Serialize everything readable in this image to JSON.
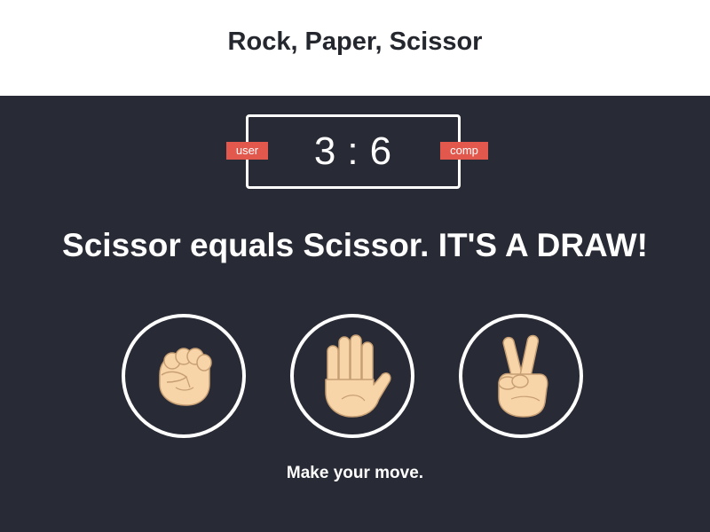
{
  "header": {
    "title": "Rock, Paper, Scissor"
  },
  "scoreboard": {
    "user_label": "user",
    "comp_label": "comp",
    "user_score": "3",
    "separator": ":",
    "comp_score": "6"
  },
  "result": {
    "message": "Scissor equals Scissor. IT'S A DRAW!"
  },
  "choices": [
    {
      "name": "rock",
      "icon": "fist-icon"
    },
    {
      "name": "paper",
      "icon": "open-hand-icon"
    },
    {
      "name": "scissor",
      "icon": "victory-hand-icon"
    }
  ],
  "action": {
    "prompt": "Make your move."
  },
  "colors": {
    "header_bg": "#ffffff",
    "game_bg": "#282a35",
    "badge_bg": "#e2584d",
    "text": "#ffffff",
    "skin": "#f8d5a8",
    "skin_outline": "#c79f74"
  }
}
